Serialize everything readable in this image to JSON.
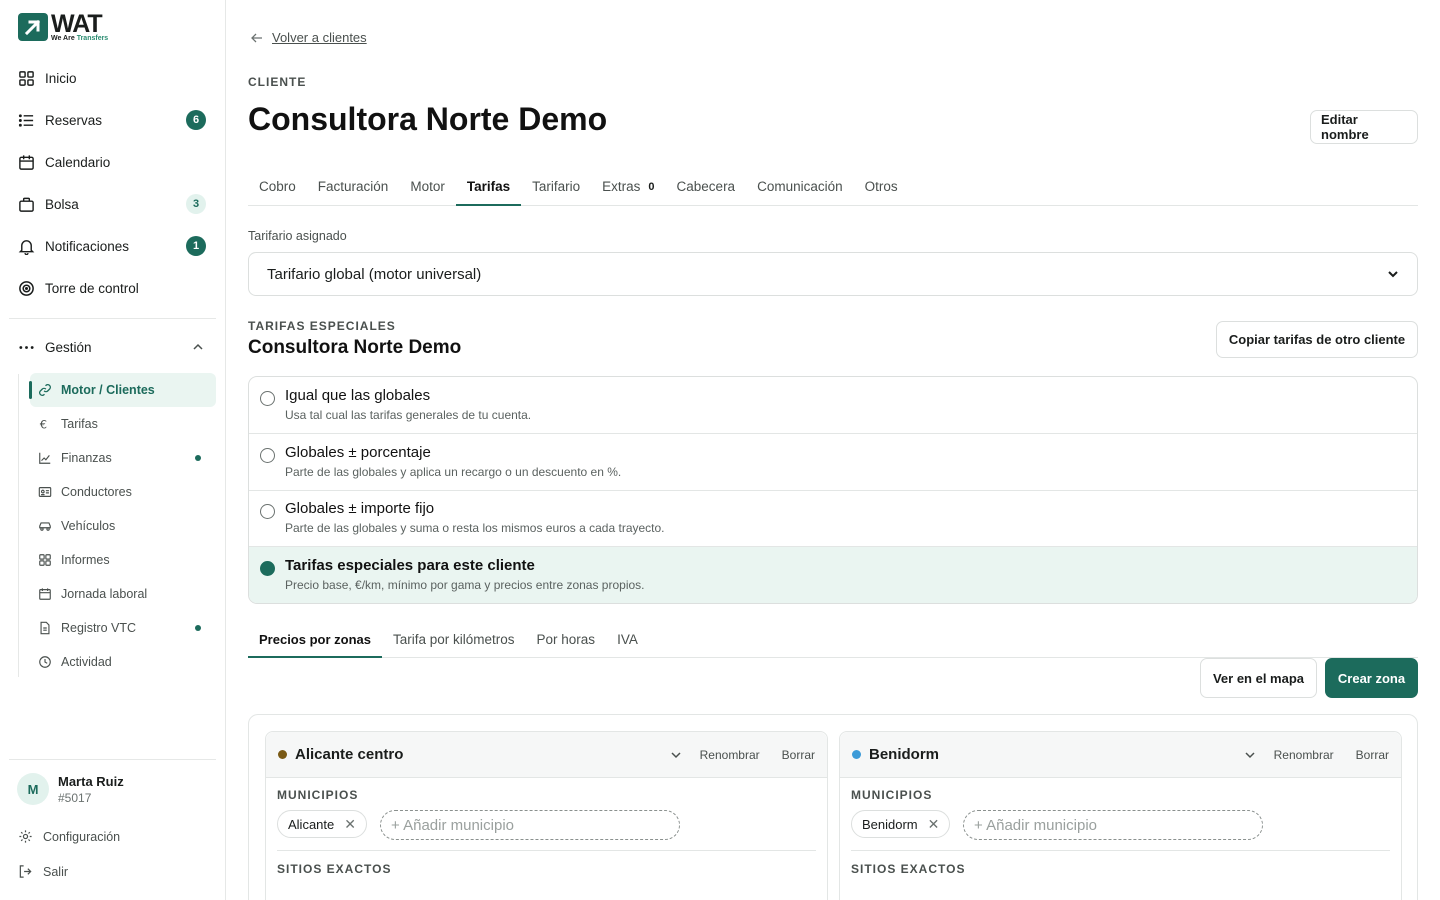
{
  "brand": {
    "name": "WAT",
    "tagline_a": "We Are ",
    "tagline_b": "Transfers"
  },
  "nav": {
    "items": [
      {
        "label": "Inicio",
        "badge": ""
      },
      {
        "label": "Reservas",
        "badge": "6"
      },
      {
        "label": "Calendario",
        "badge": ""
      },
      {
        "label": "Bolsa",
        "badge": "3"
      },
      {
        "label": "Notificaciones",
        "badge": "1"
      },
      {
        "label": "Torre de control",
        "badge": ""
      }
    ],
    "section": {
      "label": "Gestión"
    },
    "sub_items": [
      {
        "label": "Motor / Clientes"
      },
      {
        "label": "Tarifas"
      },
      {
        "label": "Finanzas"
      },
      {
        "label": "Conductores"
      },
      {
        "label": "Vehículos"
      },
      {
        "label": "Informes"
      },
      {
        "label": "Jornada laboral"
      },
      {
        "label": "Registro VTC"
      },
      {
        "label": "Actividad"
      }
    ]
  },
  "user": {
    "initial": "M",
    "name": "Marta Ruiz",
    "id": "#5017"
  },
  "footer": {
    "settings": "Configuración",
    "logout": "Salir"
  },
  "page": {
    "back": "Volver a clientes",
    "eyebrow": "CLIENTE",
    "title": "Consultora Norte Demo",
    "edit_button": "Editar nombre"
  },
  "tabs": [
    {
      "label": "Cobro",
      "count": ""
    },
    {
      "label": "Facturación",
      "count": ""
    },
    {
      "label": "Motor",
      "count": ""
    },
    {
      "label": "Tarifas",
      "count": ""
    },
    {
      "label": "Tarifario",
      "count": ""
    },
    {
      "label": "Extras",
      "count": "0"
    },
    {
      "label": "Cabecera",
      "count": ""
    },
    {
      "label": "Comunicación",
      "count": ""
    },
    {
      "label": "Otros",
      "count": ""
    }
  ],
  "tarifario": {
    "label": "Tarifario asignado",
    "value": "Tarifario global (motor universal)"
  },
  "special": {
    "eyebrow": "TARIFAS ESPECIALES",
    "title": "Consultora Norte Demo",
    "copy_button": "Copiar tarifas de otro cliente",
    "options": [
      {
        "title": "Igual que las globales",
        "desc": "Usa tal cual las tarifas generales de tu cuenta."
      },
      {
        "title": "Globales ± porcentaje",
        "desc": "Parte de las globales y aplica un recargo o un descuento en %."
      },
      {
        "title": "Globales ± importe fijo",
        "desc": "Parte de las globales y suma o resta los mismos euros a cada trayecto."
      },
      {
        "title": "Tarifas especiales para este cliente",
        "desc": "Precio base, €/km, mínimo por gama y precios entre zonas propios."
      }
    ]
  },
  "subtabs": [
    {
      "label": "Precios por zonas"
    },
    {
      "label": "Tarifa por kilómetros"
    },
    {
      "label": "Por horas"
    },
    {
      "label": "IVA"
    }
  ],
  "actions": {
    "map": "Ver en el mapa",
    "create": "Crear zona"
  },
  "zones": [
    {
      "name": "Alicante centro",
      "color": "#7a5a16",
      "rename": "Renombrar",
      "delete": "Borrar",
      "municipios_label": "MUNICIPIOS",
      "chip": "Alicante",
      "add_placeholder": "+ Añadir municipio",
      "sitios_label": "SITIOS EXACTOS"
    },
    {
      "name": "Benidorm",
      "color": "#3d9bd8",
      "rename": "Renombrar",
      "delete": "Borrar",
      "municipios_label": "MUNICIPIOS",
      "chip": "Benidorm",
      "add_placeholder": "+ Añadir municipio",
      "sitios_label": "SITIOS EXACTOS"
    }
  ],
  "colors": {
    "accent": "#1c6b5c",
    "accent_light": "#eaf5f1"
  }
}
